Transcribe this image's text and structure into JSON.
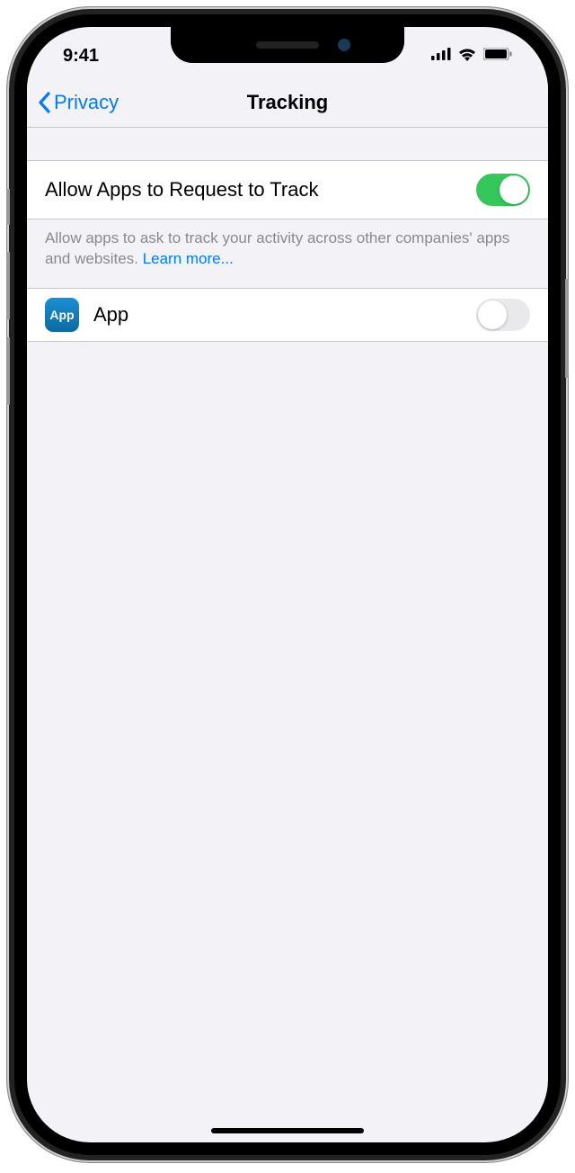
{
  "status": {
    "time": "9:41"
  },
  "nav": {
    "back_label": "Privacy",
    "title": "Tracking"
  },
  "settings": {
    "allow_tracking": {
      "label": "Allow Apps to Request to Track",
      "enabled": true,
      "footer": "Allow apps to ask to track your activity across other companies' apps and websites. ",
      "learn_more": "Learn more..."
    },
    "apps": [
      {
        "icon_text": "App",
        "name": "App",
        "enabled": false
      }
    ]
  }
}
